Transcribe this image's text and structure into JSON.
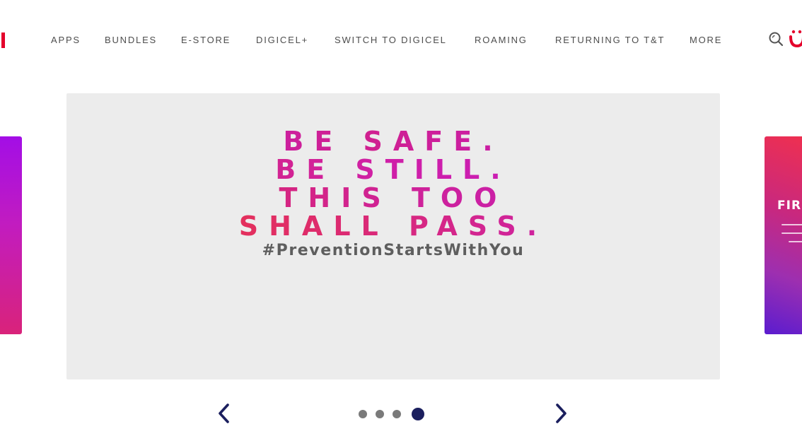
{
  "header": {
    "nav": [
      {
        "label": "APPS"
      },
      {
        "label": "BUNDLES"
      },
      {
        "label": "E-STORE"
      },
      {
        "label": "DIGICEL+"
      },
      {
        "label": "SWITCH TO DIGICEL"
      },
      {
        "label": "ROAMING"
      },
      {
        "label": "RETURNING TO T&T"
      },
      {
        "label": "MORE"
      }
    ],
    "icons": {
      "search": "search-icon",
      "brand": "digicel-logo-icon"
    },
    "brand_color": "#e4002b"
  },
  "carousel": {
    "slide": {
      "lines": [
        "BE SAFE.",
        "BE STILL.",
        "THIS TOO",
        "SHALL PASS."
      ],
      "hashtag": "#PreventionStartsWithYou"
    },
    "peek_right": {
      "title": "FIRS"
    },
    "dots": {
      "count": 4,
      "active_index": 3
    },
    "colors": {
      "slide_background": "#ececec",
      "active_dot": "#1b1f5e",
      "inactive_dot": "#7a7a7a",
      "arrow": "#1b1f5e",
      "gradient_magenta": "#c21cc8",
      "gradient_red": "#f03a3a"
    }
  }
}
